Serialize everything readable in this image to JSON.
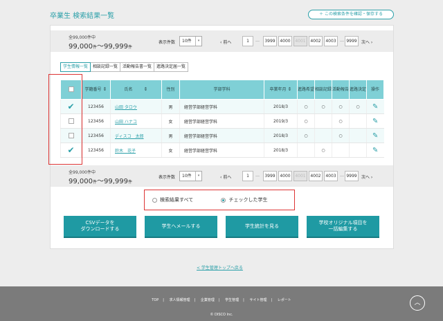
{
  "page": {
    "title": "卒業生 検索結果一覧",
    "save_condition": "＋ この検索条件を確認・保存する"
  },
  "pagination": {
    "total": "全99,000件中",
    "range_main_a": "99,000",
    "range_unit_a": "件",
    "range_sep": "～",
    "range_main_b": "99,999",
    "range_unit_b": "件",
    "per_page_label": "表示件数",
    "per_page_value": "10件",
    "prev": "前へ",
    "next": "次へ",
    "pages": [
      "1",
      "3999",
      "4000",
      "4001",
      "4002",
      "4003",
      "9999"
    ],
    "ellipsis": "…"
  },
  "tabs": [
    "学生情報一覧",
    "相談記録一覧",
    "活動報告書一覧",
    "進路決定届一覧"
  ],
  "table": {
    "headers": [
      "学籍番号",
      "氏名",
      "性別",
      "学部学科",
      "卒業年月",
      "進路希望",
      "相談記録",
      "活動報告",
      "進路決定",
      "操作"
    ],
    "rows": [
      {
        "checked": true,
        "id": "123456",
        "name": "山田 タロウ",
        "gender": "男",
        "dept": "経営学部経営学科",
        "grad": "2018/3",
        "marks": [
          "○",
          "○",
          "○",
          "○"
        ]
      },
      {
        "checked": false,
        "id": "123456",
        "name": "山田 ハナコ",
        "gender": "女",
        "dept": "経営学部経営学科",
        "grad": "2019/3",
        "marks": [
          "○",
          "",
          "○",
          ""
        ]
      },
      {
        "checked": false,
        "id": "123456",
        "name": "ディスコ　太郎",
        "gender": "男",
        "dept": "経営学部経営学科",
        "grad": "2018/3",
        "marks": [
          "○",
          "",
          "○",
          ""
        ]
      },
      {
        "checked": true,
        "id": "123456",
        "name": "鈴木　花子",
        "gender": "女",
        "dept": "経営学部経営学科",
        "grad": "2018/3",
        "marks": [
          "",
          "○",
          "",
          ""
        ]
      }
    ]
  },
  "scope": {
    "all_label": "検索結果すべて",
    "checked_label": "チェックした学生"
  },
  "actions": {
    "csv": "CSVデータを\nダウンロードする",
    "mail": "学生へメールする",
    "stats": "学生統計を見る",
    "bulk": "学校オリジナル項目を\n一括編集する"
  },
  "back_link": "< 学生管理トップへ戻る",
  "footer": {
    "nav": [
      "TOP",
      "求人情報管理",
      "企業管理",
      "学生管理",
      "サイト管理",
      "レポート"
    ],
    "copyright": "© DISCO Inc."
  },
  "colors": {
    "accent": "#2a9fa8",
    "header": "#7fd0d6",
    "button": "#1f9aa3",
    "highlight": "#dd3333"
  }
}
